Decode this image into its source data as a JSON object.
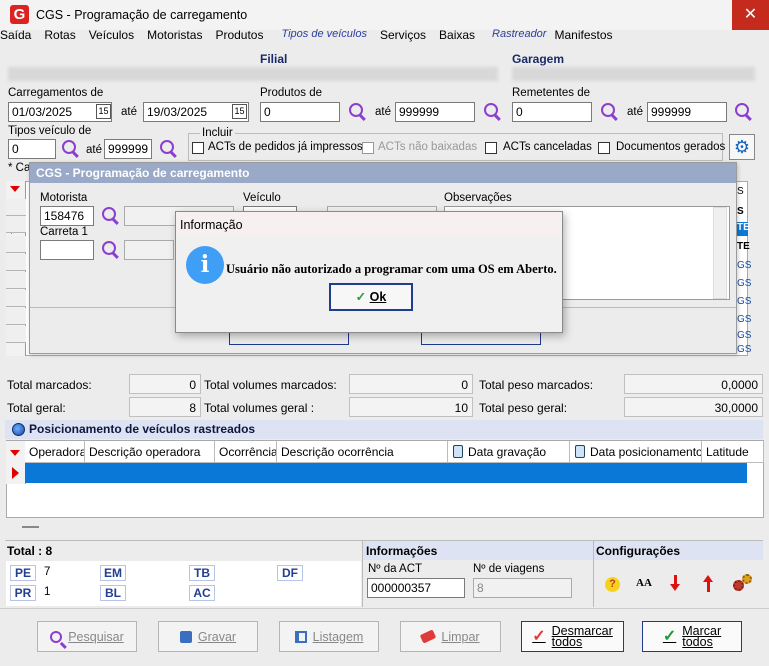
{
  "window": {
    "title": "CGS - Programação de carregamento",
    "close": "✕",
    "app_icon": "G"
  },
  "menu": [
    "Saída",
    "Rotas",
    "Veículos",
    "Motoristas",
    "Produtos",
    "Tipos de veículos",
    "Serviços",
    "Baixas",
    "Rastreador",
    "Manifestos"
  ],
  "filters": {
    "filial_label": "Filial",
    "garagem_label": "Garagem",
    "carregamentos_label": "Carregamentos de",
    "date_from": "01/03/2025",
    "date_to": "19/03/2025",
    "ate": "até",
    "produtos_label": "Produtos de",
    "produtos_from": "0",
    "produtos_to": "999999",
    "remetentes_label": "Remetentes de",
    "remetentes_from": "0",
    "remetentes_to": "999999",
    "tipos_label": "Tipos veículo de",
    "tipos_from": "0",
    "tipos_to": "999999",
    "cal_glyph": "15",
    "gear_glyph": "⚙",
    "incluir_label": "Incluir",
    "checks": [
      {
        "label": "ACTs de pedidos já impressos",
        "enabled": true
      },
      {
        "label": "ACTs não baixadas",
        "enabled": false
      },
      {
        "label": "ACTs canceladas",
        "enabled": true
      },
      {
        "label": "Documentos gerados",
        "enabled": true
      }
    ],
    "partial_label": "* Ca"
  },
  "grid_right_cells": [
    "S",
    "TE",
    "TE",
    "GS",
    "GS",
    "GS",
    "GS",
    "GS",
    "GS"
  ],
  "grid_right_header": "S",
  "inner_window": {
    "title": "CGS - Programação de carregamento",
    "motorista_label": "Motorista",
    "motorista_value": "158476",
    "veiculo_label": "Veículo",
    "observacoes_label": "Observações",
    "carreta_label": "Carreta 1"
  },
  "dialog": {
    "title": "Informação",
    "icon": "i",
    "message": "Usuário não autorizado a programar com uma OS em Aberto.",
    "ok_label": "Ok",
    "ok_mark": "✓"
  },
  "totals": {
    "marcados_label": "Total marcados:",
    "marcados_value": "0",
    "vol_marcados_label": "Total volumes marcados:",
    "vol_marcados_value": "0",
    "peso_marcados_label": "Total peso marcados:",
    "peso_marcados_value": "0,0000",
    "geral_label": "Total geral:",
    "geral_value": "8",
    "vol_geral_label": "Total volumes geral :",
    "vol_geral_value": "10",
    "peso_geral_label": "Total peso geral:",
    "peso_geral_value": "30,0000"
  },
  "tracking": {
    "title": "Posicionamento de veículos rastreados",
    "columns": [
      "Operadora",
      "Descrição operadora",
      "Ocorrência",
      "Descrição ocorrência",
      "Data gravação",
      "Data posicionamento",
      "Latitude"
    ]
  },
  "summary": {
    "total_label": "Total : 8",
    "badges": [
      {
        "code": "PE",
        "count": "7"
      },
      {
        "code": "PR",
        "count": "1"
      },
      {
        "code": "EM",
        "count": ""
      },
      {
        "code": "BL",
        "count": ""
      },
      {
        "code": "TB",
        "count": ""
      },
      {
        "code": "AC",
        "count": ""
      },
      {
        "code": "DF",
        "count": ""
      }
    ]
  },
  "informacoes": {
    "title": "Informações",
    "act_label": "Nº da ACT",
    "act_value": "000000357",
    "viagens_label": "Nº de viagens",
    "viagens_value": "8"
  },
  "configuracoes": {
    "title": "Configurações",
    "font_glyph": "AA"
  },
  "buttons": {
    "pesquisar": "Pesquisar",
    "gravar": "Gravar",
    "listagem": "Listagem",
    "limpar": "Limpar",
    "desmarcar": [
      "Desmarcar",
      "todos"
    ],
    "marcar": [
      "Marcar",
      "todos"
    ]
  },
  "colors": {
    "accent": "#0a78d7",
    "title_bar_inner": "#99a9c7",
    "close_red": "#c42b1c",
    "magnifier": "#8a3fd1"
  }
}
